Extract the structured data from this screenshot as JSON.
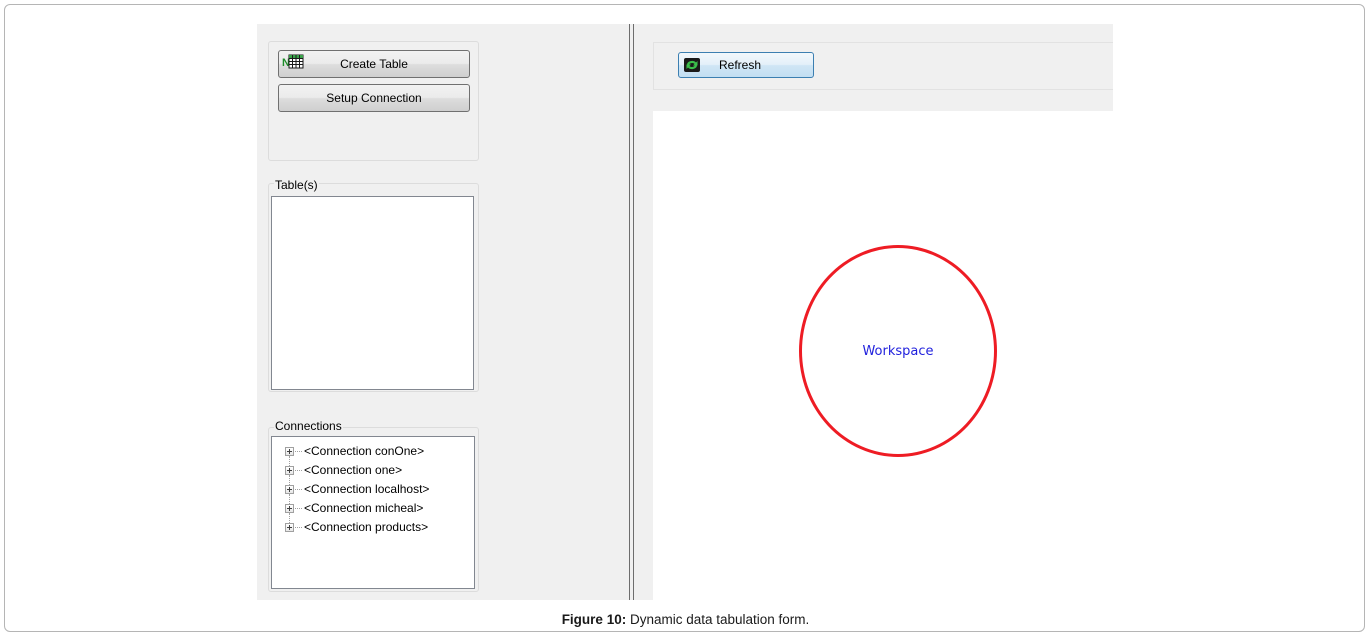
{
  "toolbar_left": {
    "create_table_label": "Create Table",
    "setup_connection_label": "Setup Connection"
  },
  "tables_group": {
    "label": "Table(s)"
  },
  "connections_group": {
    "label": "Connections",
    "items": [
      {
        "label": "<Connection conOne>"
      },
      {
        "label": "<Connection one>"
      },
      {
        "label": "<Connection localhost>"
      },
      {
        "label": "<Connection micheal>"
      },
      {
        "label": "<Connection products>"
      }
    ]
  },
  "toolbar_right": {
    "refresh_label": "Refresh"
  },
  "workspace": {
    "label": "Workspace"
  },
  "caption": {
    "prefix": "Figure 10:",
    "text": " Dynamic data tabulation form."
  },
  "colors": {
    "window_bg": "#f0f0f0",
    "workspace_circle": "#ee1c24",
    "workspace_text": "#2222dd",
    "refresh_icon": "#2e9e3a"
  },
  "icons": {
    "create_table": "new-table-grid-icon",
    "refresh": "refresh-arrows-icon",
    "tree_expander": "plus-expander-icon"
  }
}
